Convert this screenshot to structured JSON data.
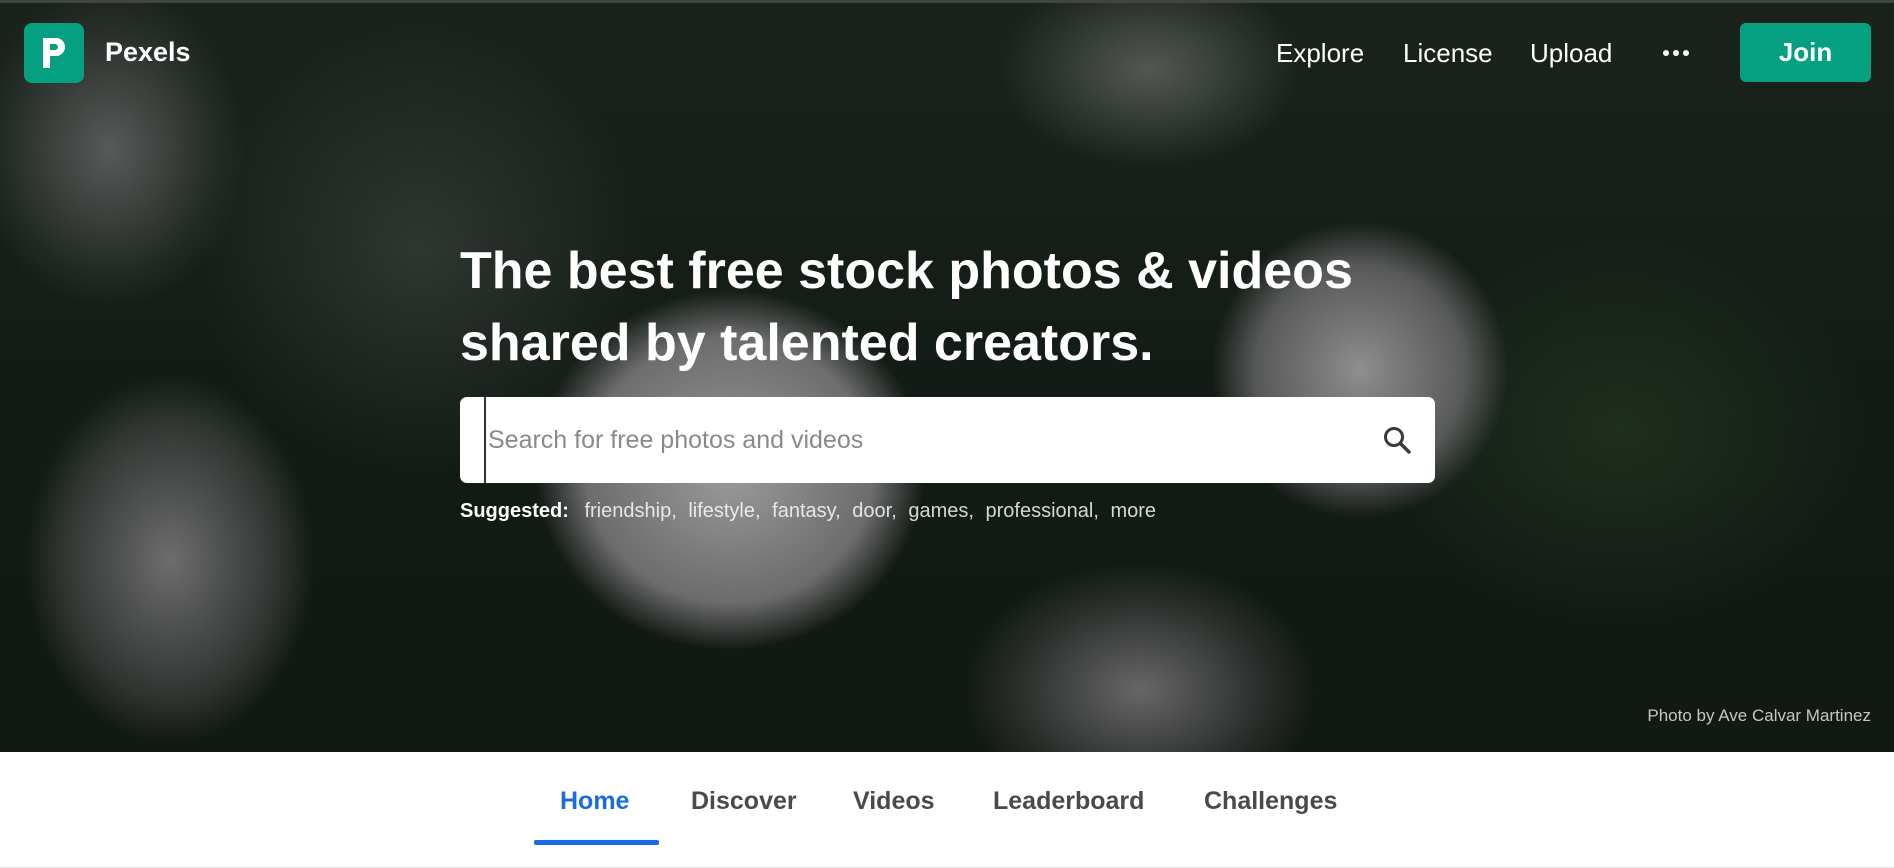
{
  "brand": {
    "name": "Pexels",
    "accent_color": "#05a081",
    "logo_icon": "pexels-p-icon"
  },
  "nav": {
    "links": [
      {
        "label": "Explore"
      },
      {
        "label": "License"
      },
      {
        "label": "Upload"
      }
    ],
    "more_icon": "more-horizontal-icon",
    "join_label": "Join"
  },
  "hero": {
    "headline_line1": "The best free stock photos & videos",
    "headline_line2": "shared by talented creators.",
    "search": {
      "placeholder": "Search for free photos and videos",
      "icon": "search-icon"
    },
    "suggested": {
      "label": "Suggested:",
      "items": [
        "friendship",
        "lifestyle",
        "fantasy",
        "door",
        "games",
        "professional",
        "more"
      ]
    },
    "credit": "Photo by Ave Calvar Martinez"
  },
  "tabs": {
    "active_color": "#1a6be6",
    "items": [
      {
        "label": "Home",
        "active": true
      },
      {
        "label": "Discover",
        "active": false
      },
      {
        "label": "Videos",
        "active": false
      },
      {
        "label": "Leaderboard",
        "active": false
      },
      {
        "label": "Challenges",
        "active": false
      }
    ]
  }
}
